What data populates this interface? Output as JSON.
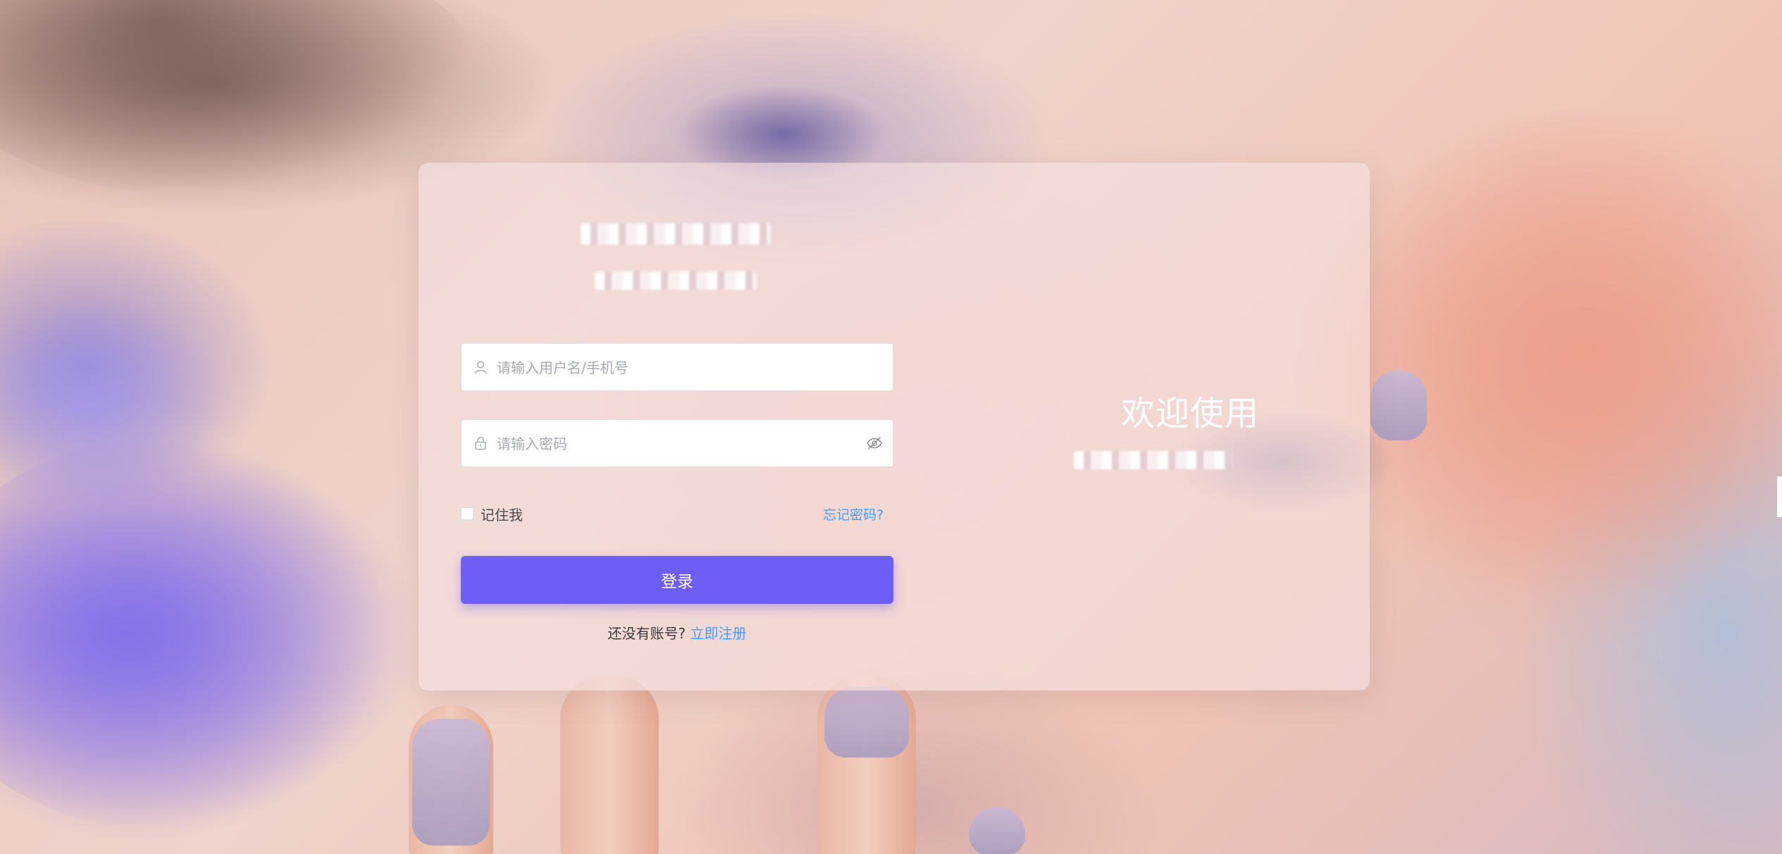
{
  "login": {
    "username_placeholder": "请输入用户名/手机号",
    "password_placeholder": "请输入密码",
    "remember_label": "记住我",
    "forgot_label": "忘记密码?",
    "submit_label": "登录",
    "no_account_text": "还没有账号?",
    "register_label": "立即注册"
  },
  "welcome": {
    "title": "欢迎使用"
  },
  "icons": {
    "username": "user-icon",
    "password": "lock-icon",
    "toggle_password": "eye-slash-icon"
  },
  "colors": {
    "primary_button": "#6d5ef7",
    "link": "#409eff"
  }
}
